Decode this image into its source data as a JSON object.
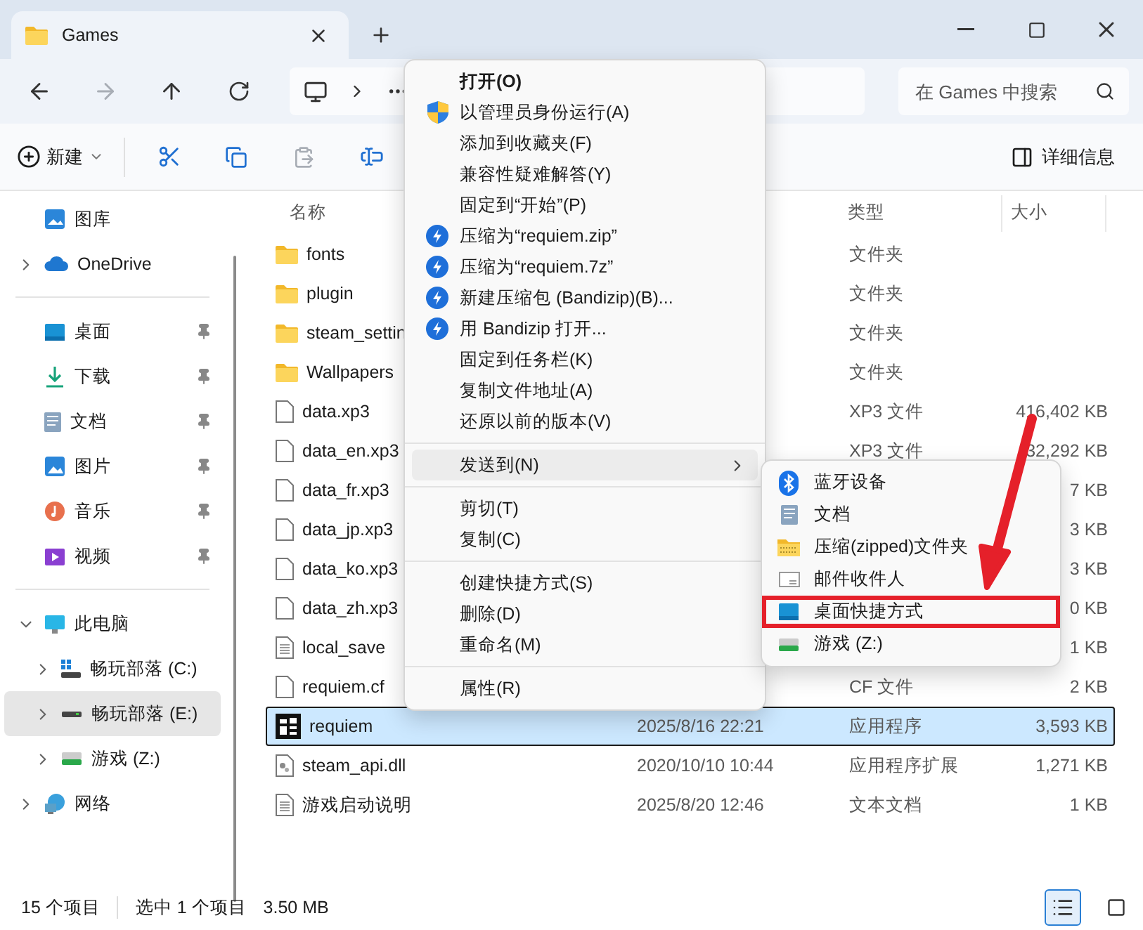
{
  "window": {
    "tab_title": "Games",
    "search": {
      "placeholder": "在 Games 中搜索"
    }
  },
  "toolbar": {
    "new_label": "新建",
    "details_label": "详细信息"
  },
  "sidebar": {
    "sections": [
      [
        {
          "label": "图库",
          "kind": "gallery",
          "pinned": false,
          "selected": false
        },
        {
          "label": "OneDrive",
          "kind": "cloud",
          "pinned": false,
          "selected": false,
          "expanded": false
        }
      ],
      [
        {
          "label": "桌面",
          "kind": "desktop",
          "pinned": true,
          "selected": false
        },
        {
          "label": "下载",
          "kind": "download",
          "pinned": true,
          "selected": false
        },
        {
          "label": "文档",
          "kind": "documents",
          "pinned": true,
          "selected": false
        },
        {
          "label": "图片",
          "kind": "pictures",
          "pinned": true,
          "selected": false
        },
        {
          "label": "音乐",
          "kind": "music",
          "pinned": true,
          "selected": false
        },
        {
          "label": "视频",
          "kind": "video",
          "pinned": true,
          "selected": false
        }
      ],
      [
        {
          "label": "此电脑",
          "kind": "pc",
          "pinned": false,
          "selected": false,
          "expanded": true,
          "children": [
            {
              "label": "畅玩部落 (C:)",
              "kind": "system",
              "pinned": false,
              "selected": false,
              "expanded": false
            },
            {
              "label": "畅玩部落 (E:)",
              "kind": "drive",
              "pinned": false,
              "selected": true,
              "expanded": false
            },
            {
              "label": "游戏 (Z:)",
              "kind": "share",
              "pinned": false,
              "selected": false,
              "expanded": false
            }
          ]
        },
        {
          "label": "网络",
          "kind": "network",
          "pinned": false,
          "selected": false,
          "expanded": false
        }
      ]
    ]
  },
  "files": {
    "columns": [
      "名称",
      "类型",
      "大小"
    ],
    "rows": [
      {
        "name": "fonts",
        "kind": "folder",
        "type": "文件夹",
        "selected": false
      },
      {
        "name": "plugin",
        "kind": "folder",
        "type": "文件夹",
        "selected": false
      },
      {
        "name": "steam_settin",
        "kind": "folder",
        "type": "文件夹",
        "selected": false
      },
      {
        "name": "Wallpapers",
        "kind": "folder",
        "type": "文件夹",
        "selected": false
      },
      {
        "name": "data.xp3",
        "kind": "file",
        "type": "XP3 文件",
        "size": "416,402 KB",
        "selected": false
      },
      {
        "name": "data_en.xp3",
        "kind": "file",
        "type": "XP3 文件",
        "size": "32,292 KB",
        "selected": false
      },
      {
        "name": "data_fr.xp3",
        "kind": "file",
        "size": "7 KB",
        "selected": false
      },
      {
        "name": "data_jp.xp3",
        "kind": "file",
        "size": "3 KB",
        "selected": false
      },
      {
        "name": "data_ko.xp3",
        "kind": "file",
        "size": "3 KB",
        "selected": false
      },
      {
        "name": "data_zh.xp3",
        "kind": "file",
        "size": "0 KB",
        "selected": false
      },
      {
        "name": "local_save",
        "kind": "text",
        "size": "1 KB",
        "selected": false
      },
      {
        "name": "requiem.cf",
        "kind": "file",
        "type": "CF 文件",
        "size": "2 KB",
        "selected": false
      },
      {
        "name": "requiem",
        "kind": "app",
        "date": "2025/8/16 22:21",
        "type": "应用程序",
        "size": "3,593 KB",
        "selected": true
      },
      {
        "name": "steam_api.dll",
        "kind": "dll",
        "date": "2020/10/10 10:44",
        "type": "应用程序扩展",
        "size": "1,271 KB",
        "selected": false
      },
      {
        "name": "游戏启动说明",
        "kind": "text",
        "date": "2025/8/20 12:46",
        "type": "文本文档",
        "size": "1 KB",
        "selected": false
      }
    ]
  },
  "context_menu": {
    "groups": [
      [
        {
          "label": "打开(O)",
          "kind": "default",
          "selected": false
        },
        {
          "label": "以管理员身份运行(A)",
          "kind": "shield",
          "selected": false
        },
        {
          "label": "添加到收藏夹(F)",
          "kind": "plain",
          "selected": false
        },
        {
          "label": "兼容性疑难解答(Y)",
          "kind": "plain",
          "selected": false
        },
        {
          "label": "固定到“开始”(P)",
          "kind": "plain",
          "selected": false
        },
        {
          "label": "压缩为“requiem.zip”",
          "kind": "bandizip",
          "selected": false
        },
        {
          "label": "压缩为“requiem.7z”",
          "kind": "bandizip",
          "selected": false
        },
        {
          "label": "新建压缩包 (Bandizip)(B)...",
          "kind": "bandizip",
          "selected": false
        },
        {
          "label": "用 Bandizip 打开...",
          "kind": "bandizip",
          "selected": false
        },
        {
          "label": "固定到任务栏(K)",
          "kind": "plain",
          "selected": false
        },
        {
          "label": "复制文件地址(A)",
          "kind": "plain",
          "selected": false
        },
        {
          "label": "还原以前的版本(V)",
          "kind": "plain",
          "selected": false
        }
      ],
      [
        {
          "label": "发送到(N)",
          "kind": "submenu",
          "selected": true
        }
      ],
      [
        {
          "label": "剪切(T)",
          "kind": "plain",
          "selected": false
        },
        {
          "label": "复制(C)",
          "kind": "plain",
          "selected": false
        }
      ],
      [
        {
          "label": "创建快捷方式(S)",
          "kind": "plain",
          "selected": false
        },
        {
          "label": "删除(D)",
          "kind": "plain",
          "selected": false
        },
        {
          "label": "重命名(M)",
          "kind": "plain",
          "selected": false
        }
      ],
      [
        {
          "label": "属性(R)",
          "kind": "plain",
          "selected": false
        }
      ]
    ]
  },
  "send_to_menu": {
    "items": [
      {
        "label": "蓝牙设备",
        "kind": "bluetooth",
        "highlighted": false
      },
      {
        "label": "文档",
        "kind": "documents",
        "highlighted": false
      },
      {
        "label": "压缩(zipped)文件夹",
        "kind": "zip",
        "highlighted": false
      },
      {
        "label": "邮件收件人",
        "kind": "mail",
        "highlighted": false
      },
      {
        "label": "桌面快捷方式",
        "kind": "desktop",
        "highlighted": true
      },
      {
        "label": "游戏 (Z:)",
        "kind": "share",
        "highlighted": false
      }
    ]
  },
  "status_bar": {
    "count": "15 个项目",
    "selection": "选中 1 个项目",
    "selection_size": "3.50 MB",
    "view_buttons": [
      {
        "kind": "details",
        "selected": true
      },
      {
        "kind": "tiles",
        "selected": false
      }
    ]
  }
}
